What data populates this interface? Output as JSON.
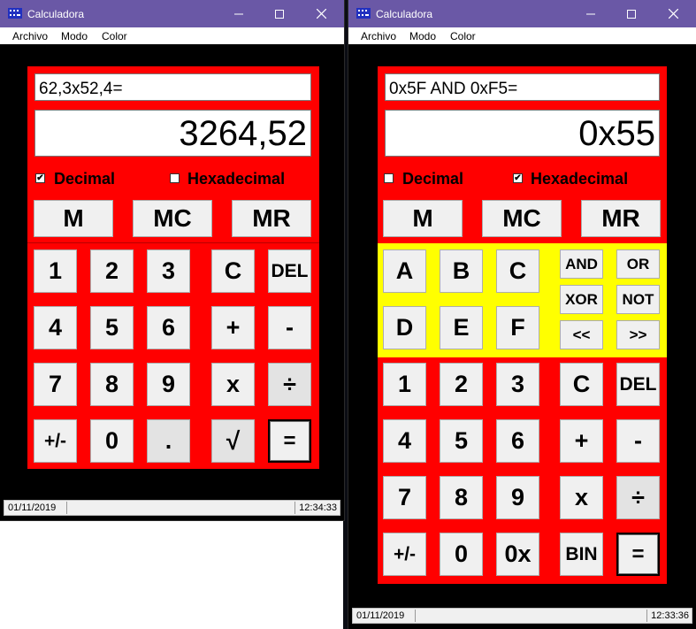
{
  "left": {
    "title": "Calculadora",
    "menu": [
      "Archivo",
      "Modo",
      "Color"
    ],
    "expression": "62,3x52,4=",
    "result": "3264,52",
    "checkbox_decimal": {
      "label": "Decimal",
      "checked": true
    },
    "checkbox_hex": {
      "label": "Hexadecimal",
      "checked": false
    },
    "memory": [
      "M",
      "MC",
      "MR"
    ],
    "keys": {
      "k1": "1",
      "k2": "2",
      "k3": "3",
      "clear": "C",
      "del": "DEL",
      "k4": "4",
      "k5": "5",
      "k6": "6",
      "plus": "+",
      "minus": "-",
      "k7": "7",
      "k8": "8",
      "k9": "9",
      "times": "x",
      "divide": "÷",
      "sign": "+/-",
      "k0": "0",
      "dot": ".",
      "sqrt": "√",
      "equals": "="
    },
    "status": {
      "date": "01/11/2019",
      "time": "12:34:33"
    }
  },
  "right": {
    "title": "Calculadora",
    "menu": [
      "Archivo",
      "Modo",
      "Color"
    ],
    "expression": "0x5F AND 0xF5=",
    "result": "0x55",
    "checkbox_decimal": {
      "label": "Decimal",
      "checked": false
    },
    "checkbox_hex": {
      "label": "Hexadecimal",
      "checked": true
    },
    "memory": [
      "M",
      "MC",
      "MR"
    ],
    "hex": {
      "a": "A",
      "b": "B",
      "c": "C",
      "d": "D",
      "e": "E",
      "f": "F"
    },
    "bitops": {
      "and": "AND",
      "or": "OR",
      "xor": "XOR",
      "not": "NOT",
      "shl": "<<",
      "shr": ">>"
    },
    "keys": {
      "k1": "1",
      "k2": "2",
      "k3": "3",
      "clear": "C",
      "del": "DEL",
      "k4": "4",
      "k5": "5",
      "k6": "6",
      "plus": "+",
      "minus": "-",
      "k7": "7",
      "k8": "8",
      "k9": "9",
      "times": "x",
      "divide": "÷",
      "sign": "+/-",
      "k0": "0",
      "hexprefix": "0x",
      "bin": "BIN",
      "equals": "="
    },
    "status": {
      "date": "01/11/2019",
      "time": "12:33:36"
    }
  },
  "colors": {
    "titlebar": "#6a58a6",
    "panel": "#ff0000",
    "hex_section": "#ffff00"
  },
  "icons": {
    "app": "calculator-icon",
    "minimize": "minimize-icon",
    "maximize": "maximize-icon",
    "close": "close-icon"
  }
}
